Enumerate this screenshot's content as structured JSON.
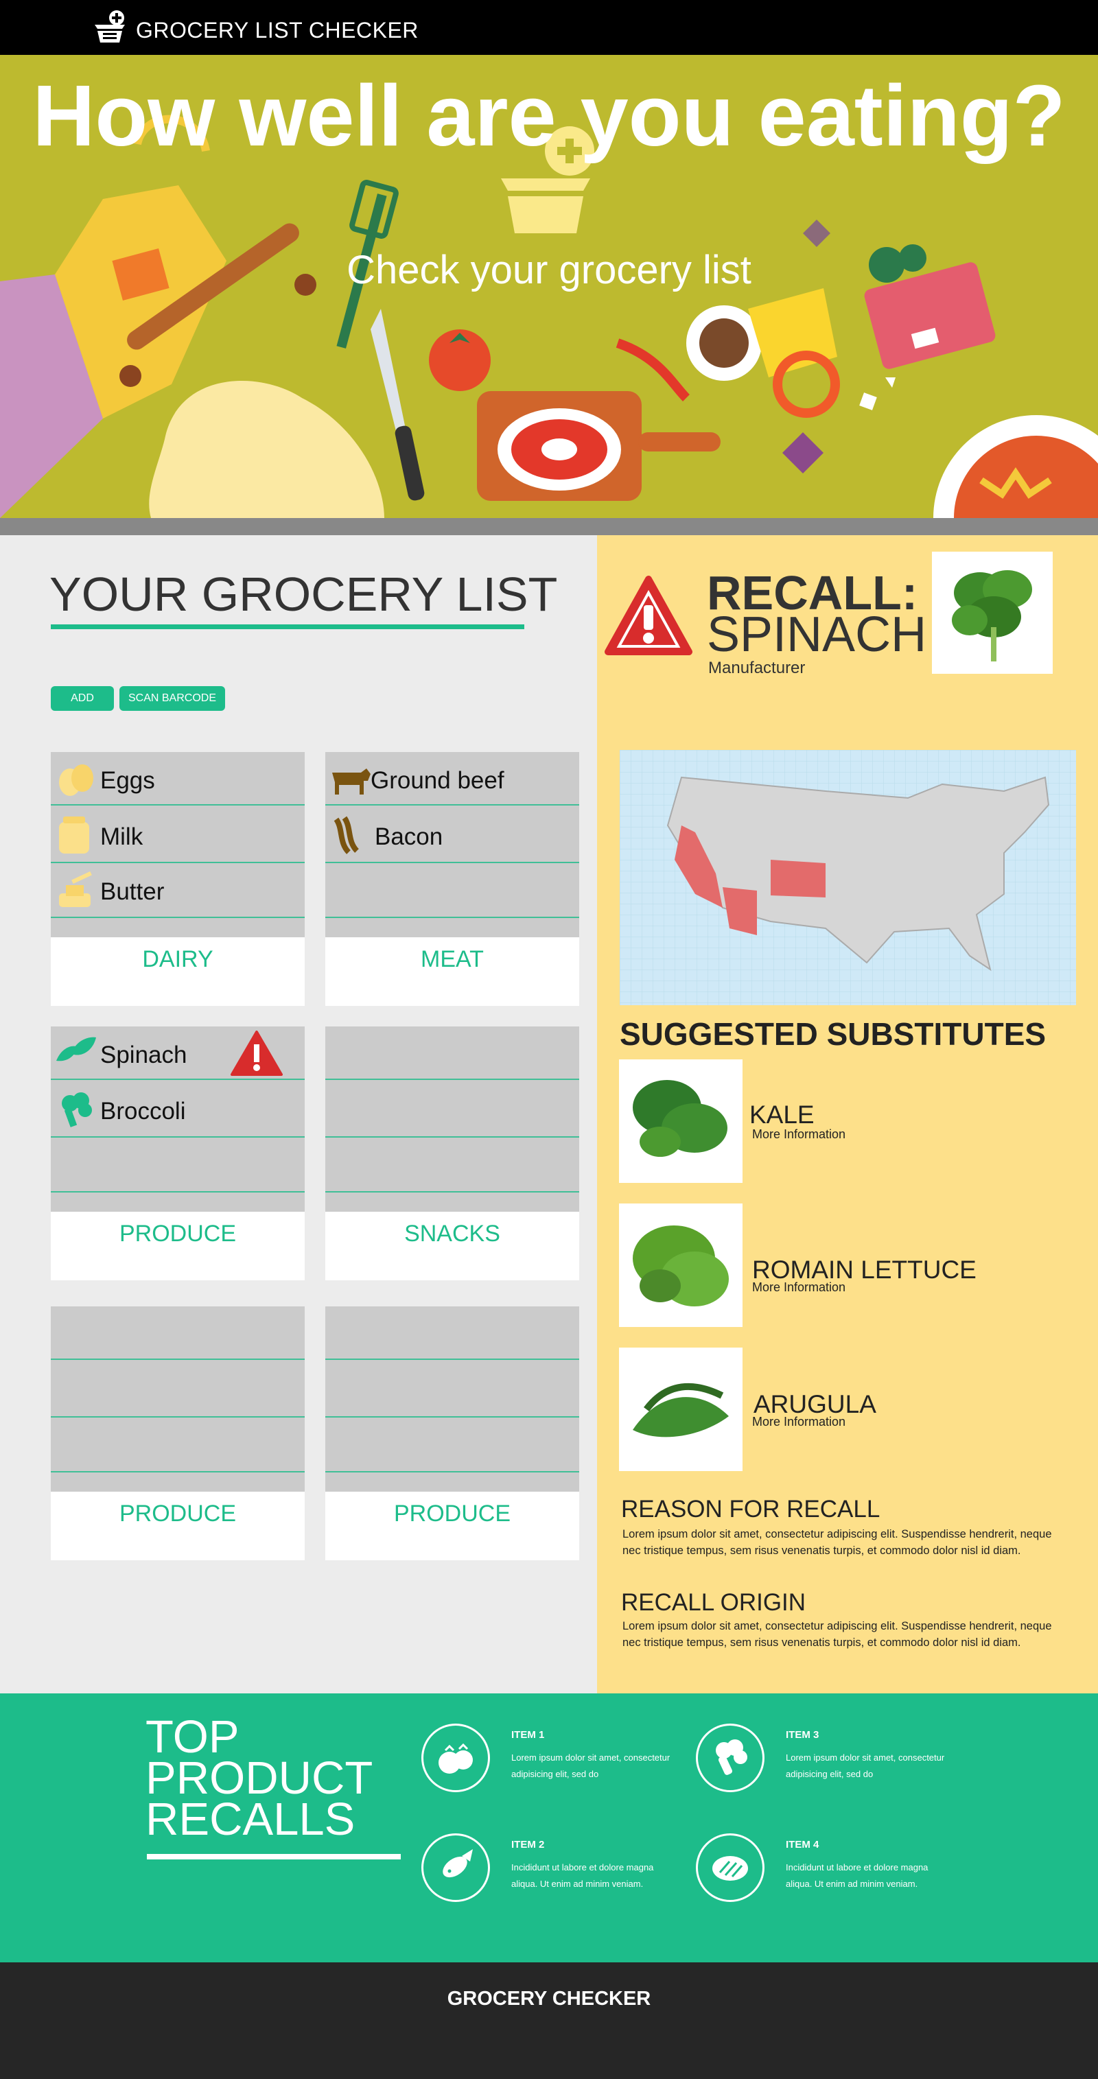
{
  "colors": {
    "accent": "#1dbc8a",
    "hero_bg": "#bdba2f",
    "recall_panel": "#fde08a",
    "alert": "#d82c2c",
    "footer": "#262626"
  },
  "header": {
    "title": "GROCERY LIST CHECKER",
    "logo_icon": "basket-plus-icon"
  },
  "hero": {
    "title": "How well are you eating?",
    "subtitle": "Check your grocery list"
  },
  "list": {
    "heading": "YOUR GROCERY LIST",
    "add_label": "ADD",
    "scan_label": "SCAN BARCODE",
    "cards": [
      {
        "category": "DAIRY",
        "items": [
          {
            "label": "Eggs",
            "icon": "eggs-icon"
          },
          {
            "label": "Milk",
            "icon": "milk-icon"
          },
          {
            "label": "Butter",
            "icon": "butter-icon"
          }
        ]
      },
      {
        "category": "MEAT",
        "items": [
          {
            "label": "Ground beef",
            "icon": "cow-icon"
          },
          {
            "label": "Bacon",
            "icon": "bacon-icon"
          }
        ]
      },
      {
        "category": "PRODUCE",
        "items": [
          {
            "label": "Spinach",
            "icon": "leaf-icon",
            "alert": true
          },
          {
            "label": "Broccoli",
            "icon": "broccoli-icon"
          }
        ]
      },
      {
        "category": "SNACKS",
        "items": []
      },
      {
        "category": "PRODUCE",
        "items": []
      },
      {
        "category": "PRODUCE",
        "items": []
      }
    ]
  },
  "recall": {
    "label": "RECALL:",
    "item": "SPINACH",
    "manufacturer": "Manufacturer",
    "substitutes_heading": "SUGGESTED SUBSTITUTES",
    "substitutes": [
      {
        "name": "KALE",
        "more": "More Information"
      },
      {
        "name": "ROMAIN LETTUCE",
        "more": "More Information"
      },
      {
        "name": "ARUGULA",
        "more": "More Information"
      }
    ],
    "reason_heading": "REASON FOR RECALL",
    "reason_text": "Lorem ipsum dolor sit amet, consectetur adipiscing elit. Suspendisse hendrerit, neque nec tristique tempus, sem risus venenatis turpis, et commodo dolor nisl id diam.",
    "origin_heading": "RECALL ORIGIN",
    "origin_text": "Lorem ipsum dolor sit amet, consectetur adipiscing elit. Suspendisse hendrerit, neque nec tristique tempus, sem risus venenatis turpis, et commodo dolor nisl id diam."
  },
  "top_recalls": {
    "heading_lines": [
      "TOP",
      "PRODUCT",
      "RECALLS"
    ],
    "items": [
      {
        "title": "ITEM 1",
        "text": "Lorem ipsum dolor sit amet, consectetur adipisicing elit, sed do",
        "icon": "tomato-icon"
      },
      {
        "title": "ITEM 3",
        "text": "Lorem ipsum dolor sit amet, consectetur adipisicing elit, sed do",
        "icon": "broccoli-icon"
      },
      {
        "title": "ITEM 2",
        "text": "Incididunt ut labore et dolore magna aliqua. Ut enim ad minim veniam.",
        "icon": "fish-icon"
      },
      {
        "title": "ITEM 4",
        "text": "Incididunt ut labore et dolore magna aliqua. Ut enim ad minim veniam.",
        "icon": "steak-icon"
      }
    ]
  },
  "footer": {
    "text": "GROCERY CHECKER"
  }
}
